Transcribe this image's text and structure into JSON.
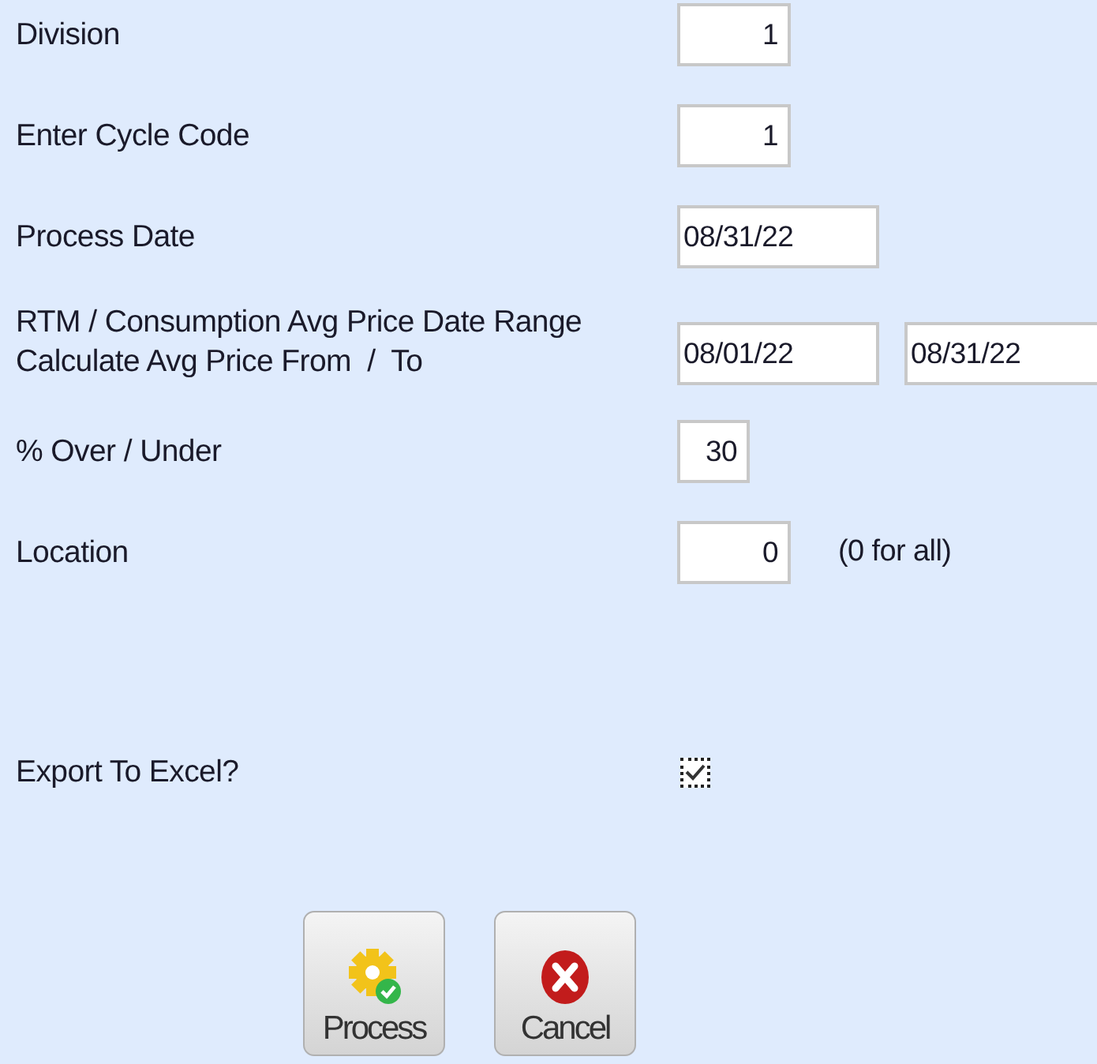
{
  "rows": [
    {
      "kind": "fields",
      "label": [
        "Division"
      ],
      "fields": [
        {
          "kind": "number",
          "value": "1"
        }
      ]
    },
    {
      "kind": "fields",
      "label": [
        "Enter Cycle Code"
      ],
      "fields": [
        {
          "kind": "number",
          "value": "1"
        }
      ]
    },
    {
      "kind": "fields",
      "label": [
        "Process Date"
      ],
      "fields": [
        {
          "kind": "date",
          "value": "08/31/22"
        }
      ]
    },
    {
      "kind": "fields",
      "label": [
        "RTM / Consumption Avg Price Date Range",
        "Calculate Avg Price From  /  To"
      ],
      "fields": [
        {
          "kind": "date",
          "value": "08/01/22"
        },
        {
          "kind": "date",
          "value": "08/31/22"
        }
      ]
    },
    {
      "kind": "fields",
      "label": [
        "% Over / Under"
      ],
      "fields": [
        {
          "kind": "number",
          "value": "30"
        }
      ]
    },
    {
      "kind": "fields",
      "label": [
        "Location"
      ],
      "fields": [
        {
          "kind": "number",
          "value": "0"
        }
      ],
      "hint": "(0 for all)"
    },
    {
      "kind": "checkbox",
      "label": [
        "Export To Excel?"
      ],
      "checked": true
    }
  ],
  "buttons": [
    {
      "kind": "process",
      "label": "Process"
    },
    {
      "kind": "cancel",
      "label": "Cancel"
    }
  ]
}
